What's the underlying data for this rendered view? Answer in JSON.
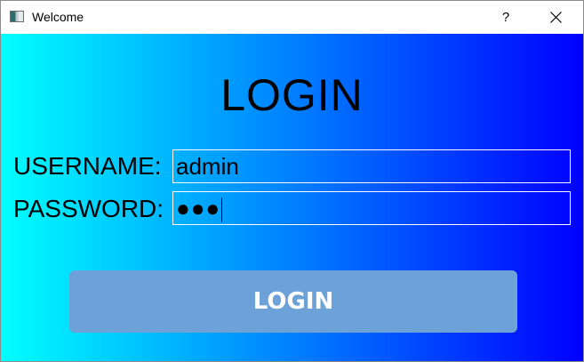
{
  "window": {
    "title": "Welcome",
    "help_label": "?",
    "icon": "app-window-icon"
  },
  "form": {
    "heading": "LOGIN",
    "username_label": "USERNAME:",
    "username_value": "admin",
    "password_label": "PASSWORD:",
    "password_masked": "●●●",
    "login_button_label": "LOGIN"
  },
  "colors": {
    "gradient_start": "#00ffff",
    "gradient_end": "#0000ff",
    "button_fill": "#6ca2d8",
    "button_text": "#ffffff"
  }
}
